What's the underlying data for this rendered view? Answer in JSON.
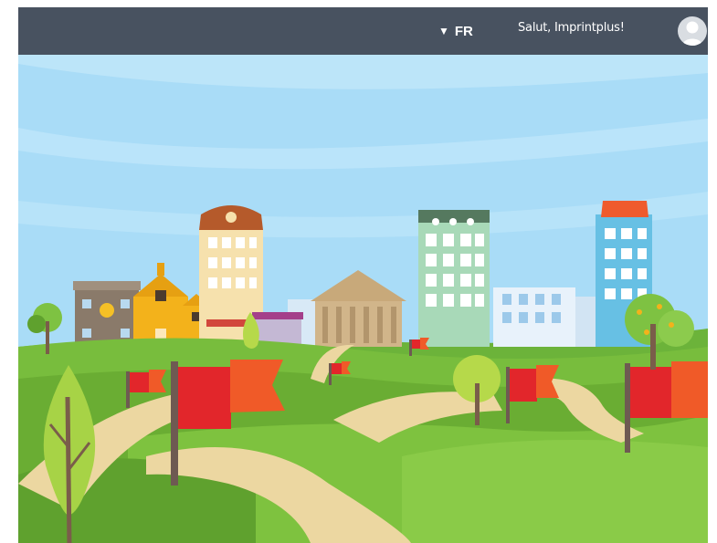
{
  "header": {
    "language_label": "FR",
    "greeting": "Salut, Imprintplus!"
  },
  "icons": {
    "language_caret": "caret-down-icon",
    "user_avatar": "user-avatar-icon"
  },
  "colors": {
    "header_bg": "#485260",
    "sky": "#a9dcf7",
    "grass": "#7cbf3b",
    "path": "#ecd7a1",
    "flag": "#e2262b"
  }
}
